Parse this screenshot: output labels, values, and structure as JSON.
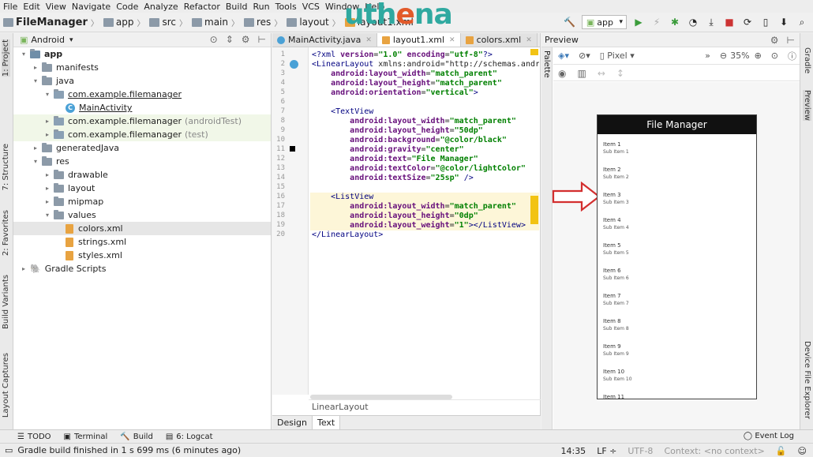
{
  "menu": [
    "File",
    "Edit",
    "View",
    "Navigate",
    "Code",
    "Analyze",
    "Refactor",
    "Build",
    "Run",
    "Tools",
    "VCS",
    "Window",
    "Help"
  ],
  "logo": {
    "part1": "uth",
    "part2": "e",
    "part3": "na"
  },
  "breadcrumbs": [
    "FileManager",
    "app",
    "src",
    "main",
    "res",
    "layout",
    "layout1.xml"
  ],
  "run_config": "app",
  "left_tabs": {
    "project": "1: Project",
    "structure": "7: Structure",
    "favorites": "2: Favorites",
    "build_variants": "Build Variants",
    "layout_captures": "Layout Captures"
  },
  "right_tabs": {
    "gradle": "Gradle",
    "preview": "Preview",
    "device_file_explorer": "Device File Explorer"
  },
  "project": {
    "view_mode": "Android",
    "tree": [
      {
        "label": "app",
        "level": 0,
        "kind": "app",
        "arrow": "▾",
        "bold": true
      },
      {
        "label": "manifests",
        "level": 1,
        "kind": "folder",
        "arrow": "▸"
      },
      {
        "label": "java",
        "level": 1,
        "kind": "folder",
        "arrow": "▾"
      },
      {
        "label": "com.example.filemanager",
        "level": 2,
        "kind": "pkg",
        "arrow": "▾",
        "underline": true
      },
      {
        "label": "MainActivity",
        "level": 3,
        "kind": "class",
        "arrow": "",
        "underline": true
      },
      {
        "label": "com.example.filemanager",
        "suffix": "(androidTest)",
        "level": 2,
        "kind": "pkg",
        "arrow": "▸",
        "hl": true
      },
      {
        "label": "com.example.filemanager",
        "suffix": "(test)",
        "level": 2,
        "kind": "pkg",
        "arrow": "▸",
        "hl": true
      },
      {
        "label": "generatedJava",
        "level": 1,
        "kind": "folder",
        "arrow": "▸"
      },
      {
        "label": "res",
        "level": 1,
        "kind": "folder",
        "arrow": "▾"
      },
      {
        "label": "drawable",
        "level": 2,
        "kind": "folder",
        "arrow": "▸"
      },
      {
        "label": "layout",
        "level": 2,
        "kind": "folder",
        "arrow": "▸"
      },
      {
        "label": "mipmap",
        "level": 2,
        "kind": "folder",
        "arrow": "▸"
      },
      {
        "label": "values",
        "level": 2,
        "kind": "folder",
        "arrow": "▾"
      },
      {
        "label": "colors.xml",
        "level": 3,
        "kind": "xml",
        "arrow": "",
        "selected": true
      },
      {
        "label": "strings.xml",
        "level": 3,
        "kind": "xml",
        "arrow": ""
      },
      {
        "label": "styles.xml",
        "level": 3,
        "kind": "xml",
        "arrow": ""
      },
      {
        "label": "Gradle Scripts",
        "level": 0,
        "kind": "gradle",
        "arrow": "▸"
      }
    ]
  },
  "editor": {
    "tabs": [
      {
        "label": "MainActivity.java",
        "icon": "class-icon",
        "active": false
      },
      {
        "label": "layout1.xml",
        "icon": "layout-icon",
        "active": true
      },
      {
        "label": "colors.xml",
        "icon": "xml-icon",
        "active": false
      }
    ],
    "line_numbers": [
      "1",
      "2",
      "3",
      "4",
      "5",
      "6",
      "7",
      "8",
      "9",
      "10",
      "11",
      "12",
      "13",
      "14",
      "15",
      "16",
      "17",
      "18",
      "19",
      "20"
    ],
    "lines": [
      "<?xml version=\"1.0\" encoding=\"utf-8\"?>",
      "<LinearLayout xmlns:android=\"http://schemas.andro",
      "    android:layout_width=\"match_parent\"",
      "    android:layout_height=\"match_parent\"",
      "    android:orientation=\"vertical\">",
      "",
      "    <TextView",
      "        android:layout_width=\"match_parent\"",
      "        android:layout_height=\"50dp\"",
      "        android:background=\"@color/black\"",
      "        android:gravity=\"center\"",
      "        android:text=\"File Manager\"",
      "        android:textColor=\"@color/lightColor\"",
      "        android:textSize=\"25sp\" />",
      "",
      "    <ListView",
      "        android:layout_width=\"match_parent\"",
      "        android:layout_height=\"0dp\"",
      "        android:layout_weight=\"1\"></ListView>",
      "</LinearLayout>"
    ],
    "bottom_crumb": "LinearLayout",
    "mode_tabs": [
      "Design",
      "Text"
    ],
    "active_mode": "Text"
  },
  "preview": {
    "title": "Preview",
    "palette_label": "Palette",
    "device": "Pixel",
    "zoom": "35%",
    "app_title": "File Manager",
    "items": [
      {
        "title": "Item 1",
        "sub": "Sub Item 1"
      },
      {
        "title": "Item 2",
        "sub": "Sub Item 2"
      },
      {
        "title": "Item 3",
        "sub": "Sub Item 3"
      },
      {
        "title": "Item 4",
        "sub": "Sub Item 4"
      },
      {
        "title": "Item 5",
        "sub": "Sub Item 5"
      },
      {
        "title": "Item 6",
        "sub": "Sub Item 6"
      },
      {
        "title": "Item 7",
        "sub": "Sub Item 7"
      },
      {
        "title": "Item 8",
        "sub": "Sub Item 8"
      },
      {
        "title": "Item 9",
        "sub": "Sub Item 9"
      },
      {
        "title": "Item 10",
        "sub": "Sub Item 10"
      },
      {
        "title": "Item 11",
        "sub": ""
      }
    ]
  },
  "bottom_tools": [
    {
      "label": "TODO",
      "icon": "todo-icon"
    },
    {
      "label": "Terminal",
      "icon": "terminal-icon"
    },
    {
      "label": "Build",
      "icon": "build-icon"
    },
    {
      "label": "6: Logcat",
      "icon": "logcat-icon"
    }
  ],
  "event_log": "Event Log",
  "status": {
    "message": "Gradle build finished in 1 s 699 ms (6 minutes ago)",
    "position": "14:35",
    "line_sep": "LF ÷",
    "encoding": "UTF-8",
    "context": "Context: <no context>"
  },
  "colors": {
    "accent_teal": "#2fa9a0",
    "accent_orange": "#e25a2a",
    "arrow_red": "#d32f2f",
    "highlight": "#fdf6d8"
  }
}
